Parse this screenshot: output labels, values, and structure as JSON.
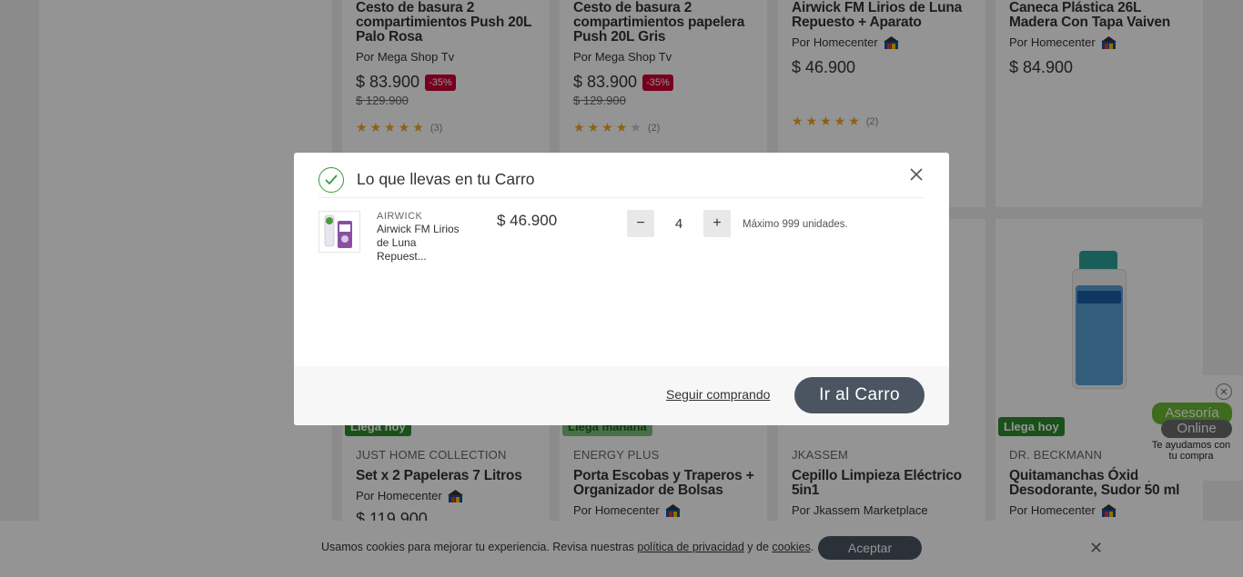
{
  "background_cards": {
    "row1": [
      {
        "title": "Cesto de basura 2 compartimientos Push 20L Palo Rosa",
        "seller": "Por Mega Shop Tv",
        "price": "$ 83.900",
        "discount": "-35%",
        "old_price": "$ 129.900",
        "rating": 4.5,
        "reviews": "(3)"
      },
      {
        "title": "Cesto de basura 2 compartimientos papelera Push 20L Gris",
        "seller": "Por Mega Shop Tv",
        "price": "$ 83.900",
        "discount": "-35%",
        "old_price": "$ 129.900",
        "rating": 4,
        "reviews": "(2)"
      },
      {
        "title": "Airwick FM Lirios de Luna Repuesto + Aparato",
        "seller": "Por Homecenter",
        "price": "$ 46.900",
        "rating": 5,
        "reviews": "(2)"
      },
      {
        "title": "Caneca Plástica 26L Madera Con Tapa Vaiven",
        "seller": "Por Homecenter",
        "price": "$ 84.900"
      }
    ],
    "row2": [
      {
        "tag": "Llega hoy",
        "brand": "JUST HOME COLLECTION",
        "title": "Set x 2 Papeleras 7 Litros",
        "seller": "Por Homecenter",
        "price": "$ 119.900"
      },
      {
        "tag": "Llega mañana",
        "brand": "ENERGY PLUS",
        "title": "Porta Escobas y Traperos + Organizador de Bolsas",
        "seller": "Por Homecenter"
      },
      {
        "brand": "JKASSEM",
        "title": "Cepillo Limpieza Eléctrico 5in1",
        "seller": "Por Jkassem Marketplace"
      },
      {
        "tag": "Llega hoy",
        "brand": "DR. BECKMANN",
        "title": "Quitamanchas Óxido, Desodorante, Sudor 50 ml",
        "seller": "Por Homecenter"
      }
    ]
  },
  "modal": {
    "title": "Lo que llevas en tu Carro",
    "item": {
      "brand": "AIRWICK",
      "name": "Airwick FM Lirios de Luna Repuest...",
      "price": "$ 46.900",
      "quantity": "4",
      "max_text": "Máximo 999 unidades."
    },
    "minus_label": "−",
    "plus_label": "+",
    "continue_label": "Seguir comprando",
    "cart_button_label": "Ir al Carro"
  },
  "cookie": {
    "text_before": "Usamos cookies para mejorar tu experiencia. Revisa nuestras ",
    "privacy_link": "política de privacidad",
    "text_middle": " y de ",
    "cookies_link": "cookies",
    "text_after": ".",
    "accept_label": "Aceptar",
    "close_glyph": "✕"
  },
  "chat": {
    "line1": "Asesoría",
    "line2": "Online",
    "subtitle": "Te ayudamos con tu compra",
    "close_glyph": "✕"
  },
  "colors": {
    "primary_button": "#4a5561",
    "discount_red": "#cc0033",
    "success_green": "#3a9a3a",
    "star": "#f5a623"
  }
}
